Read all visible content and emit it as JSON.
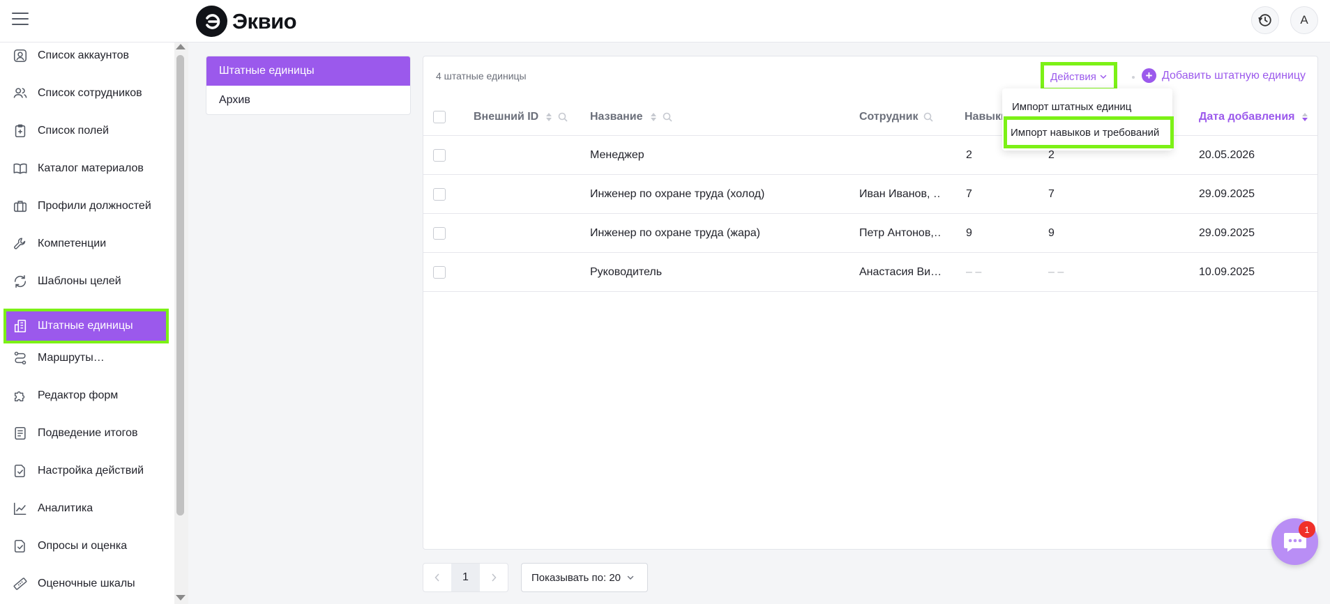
{
  "app": {
    "logo_text": "Эквио"
  },
  "header": {
    "avatar_letter": "А"
  },
  "sidebar": {
    "items": [
      {
        "label": "Список аккаунтов",
        "icon": "account-icon"
      },
      {
        "label": "Список сотрудников",
        "icon": "users-icon"
      },
      {
        "label": "Список полей",
        "icon": "clipboard-icon"
      },
      {
        "label": "Каталог материалов",
        "icon": "book-icon"
      },
      {
        "label": "Профили должностей",
        "icon": "briefcase-icon"
      },
      {
        "label": "Компетенции",
        "icon": "wrench-icon"
      },
      {
        "label": "Шаблоны целей",
        "icon": "refresh-icon"
      },
      {
        "label": "Штатные единицы",
        "icon": "building-icon",
        "active": true
      },
      {
        "label": "Маршруты…",
        "icon": "route-icon"
      },
      {
        "label": "Редактор форм",
        "icon": "puzzle-icon"
      },
      {
        "label": "Подведение итогов",
        "icon": "document-icon"
      },
      {
        "label": "Настройка действий",
        "icon": "file-check-icon"
      },
      {
        "label": "Аналитика",
        "icon": "chart-icon"
      },
      {
        "label": "Опросы и оценка",
        "icon": "survey-icon"
      },
      {
        "label": "Оценочные шкалы",
        "icon": "ruler-icon"
      }
    ]
  },
  "left_panel": {
    "items": [
      {
        "label": "Штатные единицы",
        "active": true
      },
      {
        "label": "Архив",
        "active": false
      }
    ]
  },
  "toolbar": {
    "count_text": "4 штатные единицы",
    "actions_label": "Действия",
    "add_label": "Добавить штатную единицу"
  },
  "actions_menu": {
    "items": [
      "Импорт штатных единиц",
      "Импорт навыков и требований"
    ]
  },
  "table": {
    "headers": {
      "external_id": "Внешний ID",
      "name": "Название",
      "employee": "Сотрудник",
      "skills": "Навыки",
      "date": "Дата добавления"
    },
    "rows": [
      {
        "external_id": "",
        "name": "Менеджер",
        "employee": "",
        "skills": "2",
        "requirements": "2",
        "date": "20.05.2026"
      },
      {
        "external_id": "",
        "name": "Инженер по охране труда (холод)",
        "employee": "Иван Иванов, …",
        "skills": "7",
        "requirements": "7",
        "date": "29.09.2025"
      },
      {
        "external_id": "",
        "name": "Инженер по охране труда (жара)",
        "employee": "Петр Антонов,…",
        "skills": "9",
        "requirements": "9",
        "date": "29.09.2025"
      },
      {
        "external_id": "",
        "name": "Руководитель",
        "employee": "Анастасия Ви…",
        "skills": "– –",
        "requirements": "– –",
        "date": "10.09.2025"
      }
    ]
  },
  "pagination": {
    "current_page": "1",
    "page_size_label": "Показывать по: 20"
  },
  "chat": {
    "badge_count": "1"
  },
  "colors": {
    "accent": "#9b59ec",
    "highlight": "#7cf116",
    "badge": "#f0302a"
  }
}
